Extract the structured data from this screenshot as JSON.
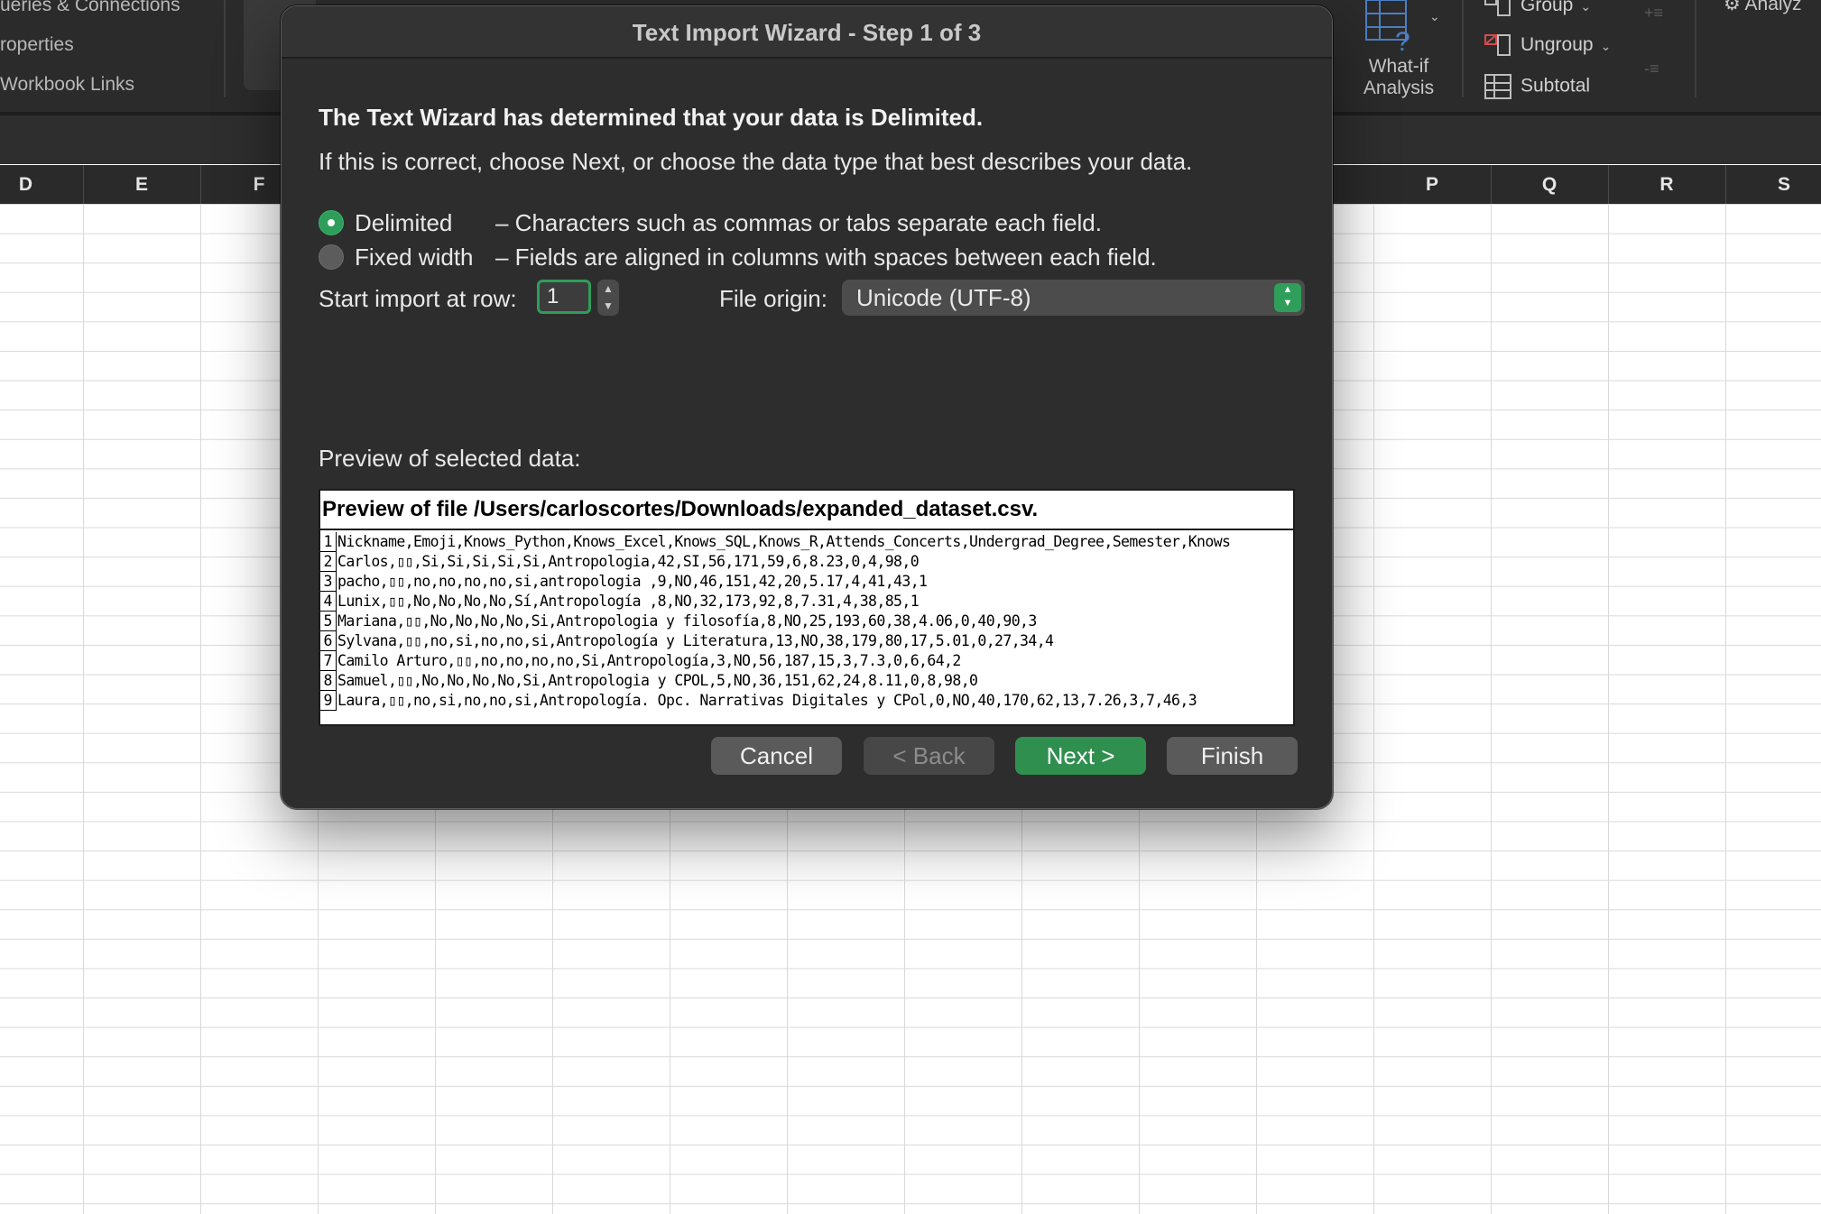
{
  "ribbon": {
    "data_items": [
      "ueries & Connections",
      "roperties",
      "Workbook Links"
    ],
    "whatif_label": "What-if\nAnalysis",
    "outline": {
      "group": "Group",
      "ungroup": "Ungroup",
      "subtotal": "Subtotal"
    },
    "analyze": "Analyz"
  },
  "columns": [
    "D",
    "E",
    "F",
    "P",
    "Q",
    "R",
    "S"
  ],
  "dialog": {
    "title": "Text Import Wizard - Step 1 of 3",
    "heading": "The Text Wizard has determined that your data is Delimited.",
    "subtext": "If this is correct, choose Next, or choose the data type that best describes your data.",
    "options": [
      {
        "label": "Delimited",
        "description": "– Characters such as commas or tabs separate each field.",
        "selected": true
      },
      {
        "label": "Fixed width",
        "description": "– Fields are aligned in columns with spaces between each field.",
        "selected": false
      }
    ],
    "start_row_label": "Start import at row:",
    "start_row_value": "1",
    "file_origin_label": "File origin:",
    "file_origin_value": "Unicode (UTF-8)",
    "preview_label": "Preview of selected data:",
    "preview_file": "Preview of file /Users/carloscortes/Downloads/expanded_dataset.csv.",
    "preview_rows": [
      {
        "n": "1",
        "text": "Nickname,Emoji,Knows_Python,Knows_Excel,Knows_SQL,Knows_R,Attends_Concerts,Undergrad_Degree,Semester,Knows"
      },
      {
        "n": "2",
        "text": "Carlos,▯▯,Si,Si,Si,Si,Si,Antropologia,42,SI,56,171,59,6,8.23,0,4,98,0"
      },
      {
        "n": "3",
        "text": "pacho,▯▯,no,no,no,no,si,antropologia ,9,NO,46,151,42,20,5.17,4,41,43,1"
      },
      {
        "n": "4",
        "text": "Lunix,▯▯,No,No,No,No,Sí,Antropología ,8,NO,32,173,92,8,7.31,4,38,85,1"
      },
      {
        "n": "5",
        "text": "Mariana,▯▯,No,No,No,No,Si,Antropologia y filosofía,8,NO,25,193,60,38,4.06,0,40,90,3"
      },
      {
        "n": "6",
        "text": "Sylvana,▯▯,no,si,no,no,si,Antropología y Literatura,13,NO,38,179,80,17,5.01,0,27,34,4"
      },
      {
        "n": "7",
        "text": "Camilo Arturo,▯▯,no,no,no,no,Si,Antropología,3,NO,56,187,15,3,7.3,0,6,64,2"
      },
      {
        "n": "8",
        "text": "Samuel,▯▯,No,No,No,No,Si,Antropologia y CPOL,5,NO,36,151,62,24,8.11,0,8,98,0"
      },
      {
        "n": "9",
        "text": "Laura,▯▯,no,si,no,no,si,Antropología. Opc. Narrativas Digitales y CPol,0,NO,40,170,62,13,7.26,3,7,46,3"
      }
    ],
    "buttons": {
      "cancel": "Cancel",
      "back": "< Back",
      "next": "Next >",
      "finish": "Finish"
    }
  },
  "colors": {
    "accent": "#2f9e5a",
    "dialog_bg": "#2d2d2d",
    "ribbon_bg": "#2b2b2b"
  }
}
